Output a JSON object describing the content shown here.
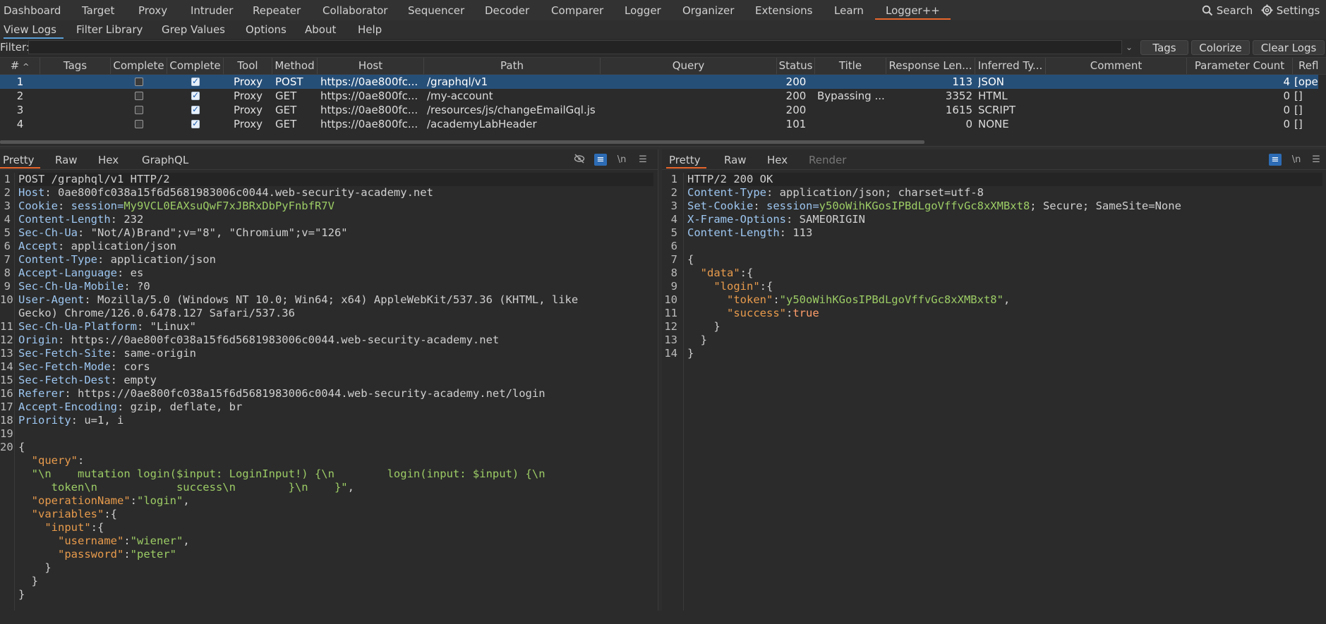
{
  "menu": [
    "Dashboard",
    "Target",
    "Proxy",
    "Intruder",
    "Repeater",
    "Collaborator",
    "Sequencer",
    "Decoder",
    "Comparer",
    "Logger",
    "Organizer",
    "Extensions",
    "Learn",
    "Logger++"
  ],
  "search_label": "Search",
  "settings_label": "Settings",
  "subtabs": [
    "View Logs",
    "Filter Library",
    "Grep Values",
    "Options",
    "About",
    "Help"
  ],
  "filter": {
    "label": "Filter:",
    "value": ""
  },
  "buttons": {
    "tags": "Tags",
    "colorize": "Colorize",
    "clear": "Clear Logs"
  },
  "columns": [
    "#",
    "Tags",
    "Complete",
    "Complete",
    "Tool",
    "Method",
    "Host",
    "Path",
    "Query",
    "Status",
    "Title",
    "Response Len...",
    "Inferred Ty...",
    "Comment",
    "Parameter Count",
    "Refl"
  ],
  "rows": [
    {
      "num": "1",
      "tags": "",
      "c1": false,
      "c2": true,
      "tool": "Proxy",
      "method": "POST",
      "host": "https://0ae800fc...",
      "path": "/graphql/v1",
      "query": "",
      "status": "200",
      "title": "",
      "len": "113",
      "type": "JSON",
      "comment": "",
      "params": "4",
      "refl": "[oper"
    },
    {
      "num": "2",
      "tags": "",
      "c1": false,
      "c2": true,
      "tool": "Proxy",
      "method": "GET",
      "host": "https://0ae800fc...",
      "path": "/my-account",
      "query": "",
      "status": "200",
      "title": "Bypassing ...",
      "len": "3352",
      "type": "HTML",
      "comment": "",
      "params": "0",
      "refl": "[]"
    },
    {
      "num": "3",
      "tags": "",
      "c1": false,
      "c2": true,
      "tool": "Proxy",
      "method": "GET",
      "host": "https://0ae800fc...",
      "path": "/resources/js/changeEmailGql.js",
      "query": "",
      "status": "200",
      "title": "",
      "len": "1615",
      "type": "SCRIPT",
      "comment": "",
      "params": "0",
      "refl": "[]"
    },
    {
      "num": "4",
      "tags": "",
      "c1": false,
      "c2": true,
      "tool": "Proxy",
      "method": "GET",
      "host": "https://0ae800fc...",
      "path": "/academyLabHeader",
      "query": "",
      "status": "101",
      "title": "",
      "len": "0",
      "type": "NONE",
      "comment": "",
      "params": "0",
      "refl": "[]"
    }
  ],
  "request": {
    "tabs": [
      "Pretty",
      "Raw",
      "Hex",
      "GraphQL"
    ],
    "line_numbers": [
      "1",
      "2",
      "3",
      "4",
      "5",
      "6",
      "7",
      "8",
      "9",
      "10",
      "",
      "11",
      "12",
      "13",
      "14",
      "15",
      "16",
      "17",
      "18",
      "19",
      "20"
    ],
    "request_line": "POST /graphql/v1 HTTP/2",
    "headers": [
      {
        "name": "Host",
        "value": "0ae800fc038a15f6d5681983006c0044.web-security-academy.net"
      },
      {
        "name": "Cookie",
        "value": "session=",
        "cookie": "My9VCL0EAXsuQwF7xJBRxDbPyFnbfR7V"
      },
      {
        "name": "Content-Length",
        "value": "232"
      },
      {
        "name": "Sec-Ch-Ua",
        "value": "\"Not/A)Brand\";v=\"8\", \"Chromium\";v=\"126\""
      },
      {
        "name": "Accept",
        "value": "application/json"
      },
      {
        "name": "Content-Type",
        "value": "application/json"
      },
      {
        "name": "Accept-Language",
        "value": "es"
      },
      {
        "name": "Sec-Ch-Ua-Mobile",
        "value": "?0"
      },
      {
        "name": "User-Agent",
        "value": "Mozilla/5.0 (Windows NT 10.0; Win64; x64) AppleWebKit/537.36 (KHTML, like"
      },
      {
        "name": "",
        "value": "Gecko) Chrome/126.0.6478.127 Safari/537.36"
      },
      {
        "name": "Sec-Ch-Ua-Platform",
        "value": "\"Linux\""
      },
      {
        "name": "Origin",
        "value": "https://0ae800fc038a15f6d5681983006c0044.web-security-academy.net"
      },
      {
        "name": "Sec-Fetch-Site",
        "value": "same-origin"
      },
      {
        "name": "Sec-Fetch-Mode",
        "value": "cors"
      },
      {
        "name": "Sec-Fetch-Dest",
        "value": "empty"
      },
      {
        "name": "Referer",
        "value": "https://0ae800fc038a15f6d5681983006c0044.web-security-academy.net/login"
      },
      {
        "name": "Accept-Encoding",
        "value": "gzip, deflate, br"
      },
      {
        "name": "Priority",
        "value": "u=1, i"
      }
    ],
    "body": {
      "query_key": "\"query\"",
      "query_val_1": "\"\\n    mutation login($input: LoginInput!) {\\n        login(input: $input) {\\n",
      "query_val_2": "token\\n            success\\n        }\\n    }\"",
      "op_key": "\"operationName\"",
      "op_val": "\"login\"",
      "vars_key": "\"variables\"",
      "input_key": "\"input\"",
      "user_key": "\"username\"",
      "user_val": "\"wiener\"",
      "pass_key": "\"password\"",
      "pass_val": "\"peter\""
    }
  },
  "response": {
    "tabs": [
      "Pretty",
      "Raw",
      "Hex",
      "Render"
    ],
    "line_numbers": [
      "1",
      "2",
      "3",
      "4",
      "5",
      "6",
      "7",
      "8",
      "9",
      "10",
      "11",
      "12",
      "13",
      "14"
    ],
    "status_line": "HTTP/2 200 OK",
    "headers": [
      {
        "name": "Content-Type",
        "value": "application/json; charset=utf-8"
      },
      {
        "name": "Set-Cookie",
        "value": "session=",
        "cookie": "y50oWihKGosIPBdLgoVffvGc8xXMBxt8",
        "rest": "; Secure; SameSite=None"
      },
      {
        "name": "X-Frame-Options",
        "value": "SAMEORIGIN"
      },
      {
        "name": "Content-Length",
        "value": "113"
      }
    ],
    "body": {
      "data_key": "\"data\"",
      "login_key": "\"login\"",
      "token_key": "\"token\"",
      "token_val": "\"y50oWihKGosIPBdLgoVffvGc8xXMBxt8\"",
      "success_key": "\"success\"",
      "success_val": "true"
    }
  },
  "icons": {
    "search": "search-icon",
    "settings": "gear-icon",
    "hide": "eye-off-icon",
    "wrap": "wrap-icon",
    "newline": "newline-icon",
    "menu": "hamburger-icon"
  },
  "colors": {
    "accent": "#e8662b",
    "selected_row": "#264f78",
    "string": "#9ccc65",
    "toggle_on": "#2d6cb5"
  }
}
